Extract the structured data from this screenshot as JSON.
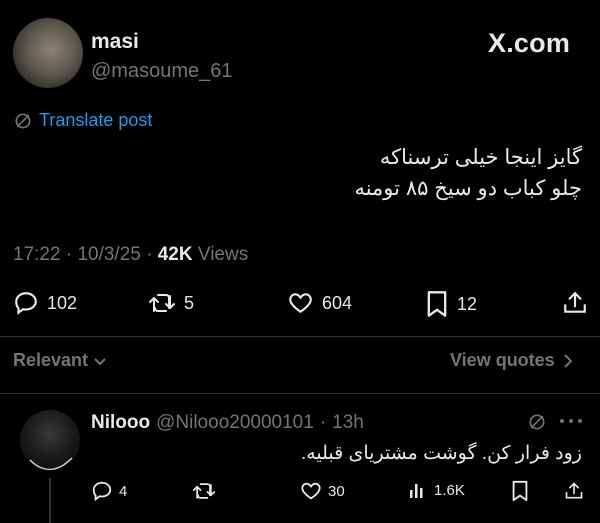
{
  "post": {
    "author_name": "masi",
    "author_handle": "@masoume_61",
    "watermark": "X.com",
    "translate_label": "Translate post",
    "text_line1": "گایز اینجا خیلی ترسناکه",
    "text_line2": "چلو کباب دو سیخ ۸۵ تومنه",
    "time": "17:22",
    "date": "10/3/25",
    "views_count": "42K",
    "views_label": "Views",
    "sep": "·",
    "actions": {
      "replies": "102",
      "reposts": "5",
      "likes": "604",
      "bookmarks": "12"
    }
  },
  "filter": {
    "sort_label": "Relevant",
    "view_quotes_label": "View quotes"
  },
  "reply": {
    "author_name": "Nilooo",
    "author_handle": "@Nilooo20000101",
    "sep": "·",
    "time": "13h",
    "text": "زود فرار کن. گوشت مشتریای قبلیه.",
    "actions": {
      "replies": "4",
      "likes": "30",
      "views": "1.6K"
    }
  },
  "colors": {
    "background": "#000000",
    "text_primary": "#e7e9ea",
    "text_secondary": "#71767b",
    "accent": "#1d9bf0",
    "divider": "#2f3336"
  },
  "icons": [
    "translate-icon",
    "reply-icon",
    "repost-icon",
    "like-icon",
    "bookmark-icon",
    "share-icon",
    "chevron-down-icon",
    "chevron-right-icon",
    "analytics-icon",
    "more-icon"
  ]
}
